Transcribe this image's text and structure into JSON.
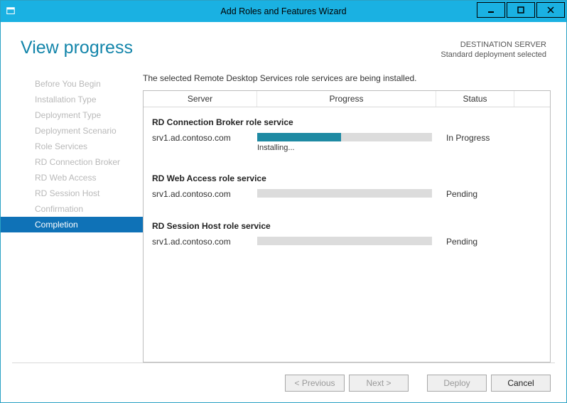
{
  "titlebar": {
    "title": "Add Roles and Features Wizard"
  },
  "header": {
    "page_title": "View progress",
    "dest_label": "DESTINATION SERVER",
    "dest_value": "Standard deployment selected"
  },
  "sidebar": {
    "items": [
      {
        "label": "Before You Begin",
        "active": false
      },
      {
        "label": "Installation Type",
        "active": false
      },
      {
        "label": "Deployment Type",
        "active": false
      },
      {
        "label": "Deployment Scenario",
        "active": false
      },
      {
        "label": "Role Services",
        "active": false
      },
      {
        "label": "RD Connection Broker",
        "active": false
      },
      {
        "label": "RD Web Access",
        "active": false
      },
      {
        "label": "RD Session Host",
        "active": false
      },
      {
        "label": "Confirmation",
        "active": false
      },
      {
        "label": "Completion",
        "active": true
      }
    ]
  },
  "main": {
    "intro": "The selected Remote Desktop Services role services are being installed.",
    "columns": {
      "server": "Server",
      "progress": "Progress",
      "status": "Status"
    },
    "sections": [
      {
        "title": "RD Connection Broker role service",
        "server": "srv1.ad.contoso.com",
        "progress_pct": 48,
        "progress_label": "Installing...",
        "status": "In Progress"
      },
      {
        "title": "RD Web Access role service",
        "server": "srv1.ad.contoso.com",
        "progress_pct": 0,
        "progress_label": "",
        "status": "Pending"
      },
      {
        "title": "RD Session Host role service",
        "server": "srv1.ad.contoso.com",
        "progress_pct": 0,
        "progress_label": "",
        "status": "Pending"
      }
    ]
  },
  "footer": {
    "previous": "< Previous",
    "next": "Next >",
    "deploy": "Deploy",
    "cancel": "Cancel"
  }
}
